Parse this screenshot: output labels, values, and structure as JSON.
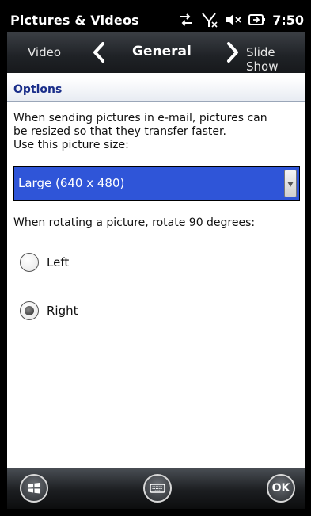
{
  "app": {
    "title": "Pictures & Videos"
  },
  "status": {
    "time": "7:50",
    "icons": [
      "sync-icon",
      "signal-off-icon",
      "volume-muted-icon",
      "battery-charging-icon"
    ]
  },
  "tabs": {
    "previous": "Video",
    "current": "General",
    "next": "Slide Show"
  },
  "section": {
    "title": "Options"
  },
  "description": {
    "line1": "When sending pictures in e-mail, pictures can",
    "line2": "be resized so that they transfer faster.",
    "line3": "Use this picture size:"
  },
  "picture_size": {
    "selected": "Large (640 x 480)"
  },
  "rotation": {
    "label": "When rotating a picture, rotate 90 degrees:",
    "options": [
      {
        "label": "Left",
        "checked": false
      },
      {
        "label": "Right",
        "checked": true
      }
    ]
  },
  "command_bar": {
    "ok_label": "OK"
  },
  "colors": {
    "selection": "#2f55d8",
    "header_text": "#1a2e8a"
  }
}
